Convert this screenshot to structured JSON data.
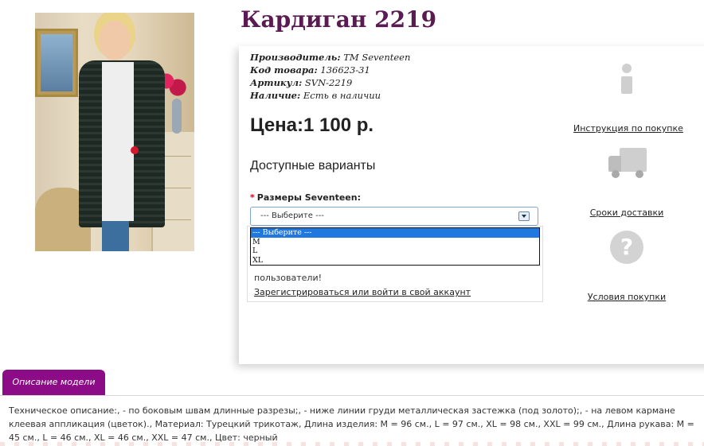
{
  "product": {
    "title": "Кардиган 2219",
    "meta": [
      {
        "label": "Производитель:",
        "value": "TM Seventeen"
      },
      {
        "label": "Код товара:",
        "value": "136623-31"
      },
      {
        "label": "Артикул:",
        "value": "SVN-2219"
      },
      {
        "label": "Наличие:",
        "value": "Есть в наличии"
      }
    ],
    "price": "Цена:1 100 р.",
    "variants_heading": "Доступные варианты",
    "size_required_mark": "*",
    "size_label": "Размеры Seventeen:",
    "size_select": {
      "value": "--- Выберите ---",
      "options": [
        "--- Выберите ---",
        "M",
        "L",
        "XL"
      ]
    },
    "register": {
      "text": "пользователи!",
      "link": "Зарегистрироваться или войти в свой аккаунт"
    }
  },
  "info": {
    "items": [
      {
        "icon": "info-icon",
        "label": "Инструкция по покупке"
      },
      {
        "icon": "truck-icon",
        "label": "Сроки доставки"
      },
      {
        "icon": "question-icon",
        "label": "Условия покупки"
      }
    ]
  },
  "description": {
    "tab_label": "Описание модели",
    "text": "Техническое описание:, - по боковым швам длинные разрезы;, - ниже линии груди металлическая застежка (под золото);, - на левом кармане клеевая аппликация (цветок)., Материал: Турецкий трикотаж, Длина изделия: M = 96 см., L = 97 см., XL = 98 см., XXL = 99 см., Длина рукава: M = 45 см., L = 46 см., XL = 46 см., XXL = 47 см., Цвет: черный"
  },
  "colors": {
    "title": "#5a1b52",
    "tab": "#8b0c86",
    "selected_option": "#1e78e0",
    "required": "#d0021b"
  }
}
